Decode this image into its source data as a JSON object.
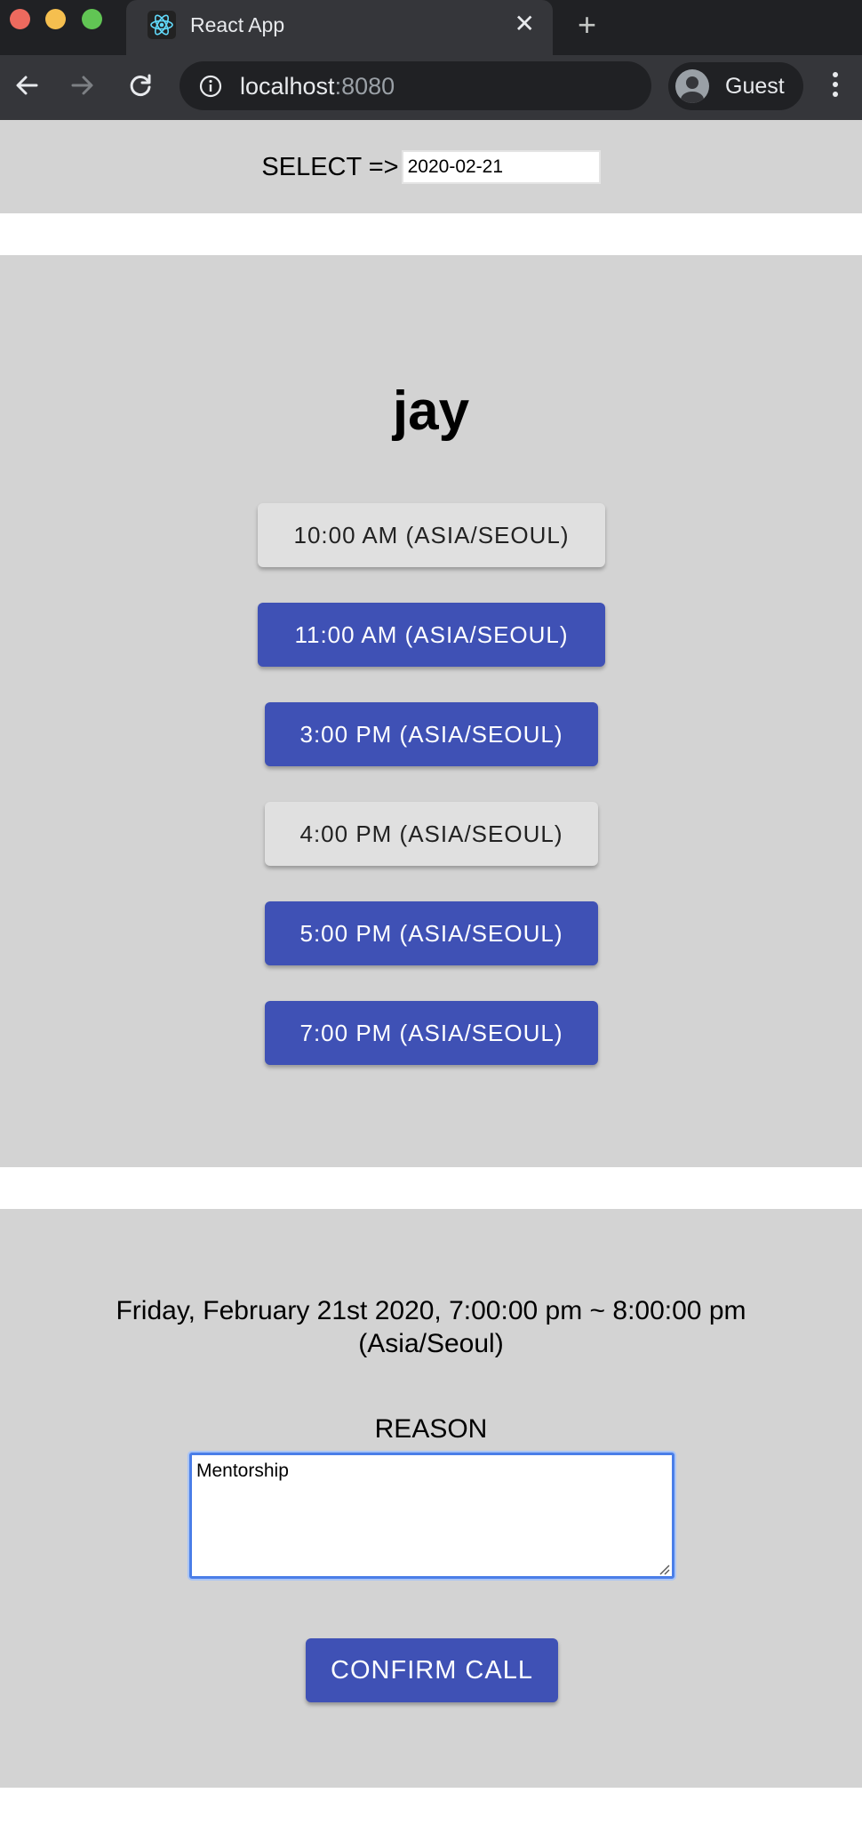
{
  "browser": {
    "tab_title": "React App",
    "tab_close": "✕",
    "new_tab": "+",
    "url_host": "localhost",
    "url_port": ":8080",
    "profile_label": "Guest"
  },
  "date_picker": {
    "label": "SELECT =>",
    "value": "2020-02-21"
  },
  "schedule": {
    "person_name": "jay",
    "slots": [
      {
        "label": "10:00 AM (ASIA/SEOUL)",
        "state": "inactive"
      },
      {
        "label": "11:00 AM (ASIA/SEOUL)",
        "state": "active"
      },
      {
        "label": "3:00 PM (ASIA/SEOUL)",
        "state": "active"
      },
      {
        "label": "4:00 PM (ASIA/SEOUL)",
        "state": "inactive"
      },
      {
        "label": "5:00 PM (ASIA/SEOUL)",
        "state": "active"
      },
      {
        "label": "7:00 PM (ASIA/SEOUL)",
        "state": "active"
      }
    ]
  },
  "confirm": {
    "selected_range_line1": "Friday, February 21st 2020, 7:00:00 pm ~ 8:00:00 pm",
    "selected_range_line2": "(Asia/Seoul)",
    "reason_label": "REASON",
    "reason_value": "Mentorship",
    "confirm_label": "CONFIRM CALL"
  },
  "colors": {
    "primary": "#3f51b5",
    "inactive_button": "#e0e0e0",
    "section_background": "#d3d3d3"
  }
}
